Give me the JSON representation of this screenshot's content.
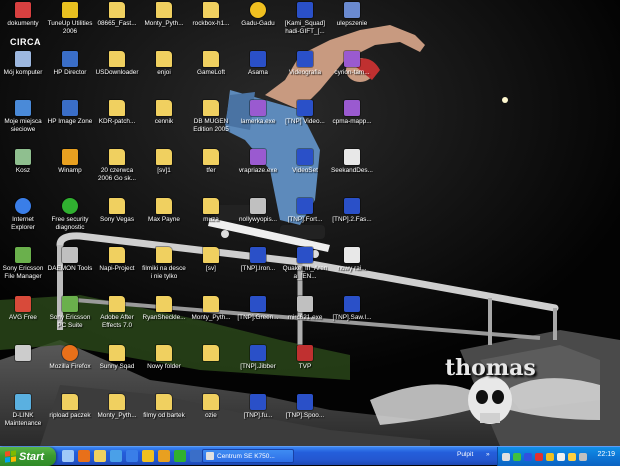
{
  "desktop": {
    "icons": [
      {
        "label": "dokumenty",
        "icon": "documents-icon",
        "color": "#d84040"
      },
      {
        "label": "Mój komputer",
        "icon": "computer-icon",
        "color": "#9db8e0"
      },
      {
        "label": "Moje miejsca sieciowe",
        "icon": "network-icon",
        "color": "#4a8ad8"
      },
      {
        "label": "Kosz",
        "icon": "recycle-bin-icon",
        "color": "#8fbf8f"
      },
      {
        "label": "Internet Explorer",
        "icon": "internet-explorer-icon",
        "color": "#3a7ee8"
      },
      {
        "label": "Sony Ericsson File Manager",
        "icon": "phone-icon",
        "color": "#6ab04c"
      },
      {
        "label": "AVG Free",
        "icon": "antivirus-icon",
        "color": "#d84a3a"
      },
      {
        "label": "",
        "icon": "monitor-icon",
        "color": "#cccccc"
      },
      {
        "label": "D-LINK Maintenance",
        "icon": "router-icon",
        "color": "#5ab0e0"
      },
      {
        "label": "TuneUp Utilities 2006",
        "icon": "tuneup-icon",
        "color": "#e8c020"
      },
      {
        "label": "HP Director",
        "icon": "hp-icon",
        "color": "#3a6ec8"
      },
      {
        "label": "HP Image Zone",
        "icon": "image-zone-icon",
        "color": "#3a6ec8"
      },
      {
        "label": "Winamp",
        "icon": "winamp-icon",
        "color": "#e8a020"
      },
      {
        "label": "Free security diagnostic",
        "icon": "security-icon",
        "color": "#30b030"
      },
      {
        "label": "DAEMON Tools",
        "icon": "daemon-tools-icon",
        "color": "#c0c0c0"
      },
      {
        "label": "Sony Ericsson PC Suite",
        "icon": "pc-suite-icon",
        "color": "#6ab04c"
      },
      {
        "label": "Mozilla Firefox",
        "icon": "firefox-icon",
        "color": "#e8701a"
      },
      {
        "label": "ripload paczek",
        "icon": "folder-icon",
        "color": "#f0d060"
      },
      {
        "label": "08665_Fast...",
        "icon": "folder-icon",
        "color": "#f0d060"
      },
      {
        "label": "USDownloader",
        "icon": "folder-icon",
        "color": "#f0d060"
      },
      {
        "label": "KDR-patch...",
        "icon": "folder-icon",
        "color": "#f0d060"
      },
      {
        "label": "20 czerwca 2006 Go sk...",
        "icon": "folder-icon",
        "color": "#f0d060"
      },
      {
        "label": "Sony Vegas",
        "icon": "folder-icon",
        "color": "#f0d060"
      },
      {
        "label": "Napi-Project",
        "icon": "folder-icon",
        "color": "#f0d060"
      },
      {
        "label": "Adobe After Effects 7.0",
        "icon": "folder-icon",
        "color": "#f0d060"
      },
      {
        "label": "Sunny Sqad",
        "icon": "folder-icon",
        "color": "#f0d060"
      },
      {
        "label": "Monty_Pyth...",
        "icon": "folder-icon",
        "color": "#f0d060"
      },
      {
        "label": "Monty_Pyth...",
        "icon": "folder-icon",
        "color": "#f0d060"
      },
      {
        "label": "enjoi",
        "icon": "folder-icon",
        "color": "#f0d060"
      },
      {
        "label": "cennik",
        "icon": "folder-icon",
        "color": "#f0d060"
      },
      {
        "label": "[sv]1",
        "icon": "folder-icon",
        "color": "#f0d060"
      },
      {
        "label": "Max Payne",
        "icon": "folder-icon",
        "color": "#f0d060"
      },
      {
        "label": "filmiki na desce i nie tylko",
        "icon": "folder-icon",
        "color": "#f0d060"
      },
      {
        "label": "RyanSheckle...",
        "icon": "folder-icon",
        "color": "#f0d060"
      },
      {
        "label": "Nowy folder",
        "icon": "folder-icon",
        "color": "#f0d060"
      },
      {
        "label": "filmy od bartek",
        "icon": "folder-icon",
        "color": "#f0d060"
      },
      {
        "label": "rockbox-h1...",
        "icon": "folder-icon",
        "color": "#f0d060"
      },
      {
        "label": "GameLoft",
        "icon": "folder-icon",
        "color": "#f0d060"
      },
      {
        "label": "DB MUGEN Edition 2005",
        "icon": "folder-icon",
        "color": "#f0d060"
      },
      {
        "label": "tfer",
        "icon": "folder-icon",
        "color": "#f0d060"
      },
      {
        "label": "muza",
        "icon": "folder-icon",
        "color": "#f0d060"
      },
      {
        "label": "[sv]",
        "icon": "folder-icon",
        "color": "#f0d060"
      },
      {
        "label": "Monty_Pyth...",
        "icon": "folder-icon",
        "color": "#f0d060"
      },
      {
        "label": "",
        "icon": "folder-icon",
        "color": "#f0d060"
      },
      {
        "label": "ozie",
        "icon": "folder-icon",
        "color": "#f0d060"
      },
      {
        "label": "Gadu-Gadu",
        "icon": "gadu-gadu-icon",
        "color": "#f0c020"
      },
      {
        "label": "Asama",
        "icon": "video-file-icon",
        "color": "#2a50c8"
      },
      {
        "label": "lamerka.exe",
        "icon": "archive-icon",
        "color": "#9a5ad0"
      },
      {
        "label": "vrapriaze.exe",
        "icon": "archive-icon",
        "color": "#9a5ad0"
      },
      {
        "label": "nollywyopis...",
        "icon": "script-icon",
        "color": "#c0c0c0"
      },
      {
        "label": "[TNP].Iron...",
        "icon": "video-file-icon",
        "color": "#2a50c8"
      },
      {
        "label": "[TNP].Green...",
        "icon": "video-file-icon",
        "color": "#2a50c8"
      },
      {
        "label": "[TNP].Jibber",
        "icon": "video-file-icon",
        "color": "#2a50c8"
      },
      {
        "label": "[TNP].fu...",
        "icon": "video-file-icon",
        "color": "#2a50c8"
      },
      {
        "label": "[Kami_Squad] hadi-GIFT_[...",
        "icon": "video-file-icon",
        "color": "#2a50c8"
      },
      {
        "label": "Videografia",
        "icon": "video-file-icon",
        "color": "#2a50c8"
      },
      {
        "label": "[TNP] Video...",
        "icon": "video-file-icon",
        "color": "#2a50c8"
      },
      {
        "label": "VideoSet",
        "icon": "video-file-icon",
        "color": "#2a50c8"
      },
      {
        "label": "[TNP].Fort...",
        "icon": "video-file-icon",
        "color": "#2a50c8"
      },
      {
        "label": "Quake_III_Arena_[EN...",
        "icon": "video-file-icon",
        "color": "#2a50c8"
      },
      {
        "label": "mirc621.exe",
        "icon": "mirc-icon",
        "color": "#c0c0c0"
      },
      {
        "label": "TVP",
        "icon": "tvp-icon",
        "color": "#c03030"
      },
      {
        "label": "[TNP].Spoo...",
        "icon": "video-file-icon",
        "color": "#2a50c8"
      },
      {
        "label": "ulepszenie",
        "icon": "network-icon",
        "color": "#6a8ad0"
      },
      {
        "label": "cyrion-tam...",
        "icon": "archive-icon",
        "color": "#9a5ad0"
      },
      {
        "label": "cpma-mapp...",
        "icon": "archive-icon",
        "color": "#9a5ad0"
      },
      {
        "label": "SeekandDes...",
        "icon": "text-file-icon",
        "color": "#e8e8e8"
      },
      {
        "label": "[TNP].2.Fas...",
        "icon": "video-file-icon",
        "color": "#2a50c8"
      },
      {
        "label": "nowy rai...",
        "icon": "text-file-icon",
        "color": "#e8e8e8"
      },
      {
        "label": "[TNP].Saw.I...",
        "icon": "video-file-icon",
        "color": "#2a50c8"
      }
    ],
    "circa_logo_text": "CIRCA",
    "wallpaper_text": "thomas"
  },
  "taskbar": {
    "start_label": "Start",
    "quicklaunch": [
      {
        "icon": "show-desktop-icon",
        "color": "#9fc8f8"
      },
      {
        "icon": "firefox-icon",
        "color": "#e8701a"
      },
      {
        "icon": "folder-icon",
        "color": "#f0d060"
      },
      {
        "icon": "media-player-icon",
        "color": "#4aa0e8"
      },
      {
        "icon": "internet-explorer-icon",
        "color": "#3a7ee8"
      },
      {
        "icon": "gadu-gadu-icon",
        "color": "#f0c020"
      },
      {
        "icon": "winamp-icon",
        "color": "#e8a020"
      },
      {
        "icon": "messenger-icon",
        "color": "#30b030"
      },
      {
        "icon": "outlook-icon",
        "color": "#3a6ec8"
      },
      {
        "icon": "notepad-icon",
        "color": "#e0e0e0"
      },
      {
        "icon": "paint-icon",
        "color": "#e05050"
      }
    ],
    "active_window": "Centrum SE K750...",
    "pulpit_label": "Pulpit",
    "pulpit_arrow": "»",
    "tray": [
      {
        "icon": "volume-icon",
        "color": "#e0e0e0"
      },
      {
        "icon": "network-tray-icon",
        "color": "#40c040"
      },
      {
        "icon": "bluetooth-icon",
        "color": "#3050e0"
      },
      {
        "icon": "antivirus-tray-icon",
        "color": "#e03030"
      },
      {
        "icon": "gadu-tray-icon",
        "color": "#f0c020"
      },
      {
        "icon": "language-icon",
        "color": "#f0f0f0"
      },
      {
        "icon": "update-icon",
        "color": "#ffd040"
      },
      {
        "icon": "daemon-tray-icon",
        "color": "#c0c0c0"
      }
    ],
    "clock": "22:19"
  }
}
